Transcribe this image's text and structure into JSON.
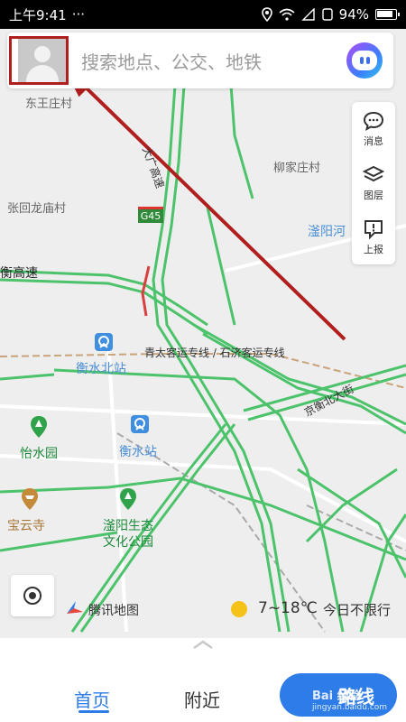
{
  "status_bar": {
    "time": "上午9:41",
    "dots": "···",
    "battery": "94%"
  },
  "search": {
    "placeholder": "搜索地点、公交、地铁"
  },
  "tools": [
    {
      "label": "消息",
      "icon": "message-icon"
    },
    {
      "label": "图层",
      "icon": "layers-icon"
    },
    {
      "label": "上报",
      "icon": "report-icon"
    }
  ],
  "map_labels": {
    "village_1": "东王庄村",
    "village_2": "柳家庄村",
    "village_3": "张回龙庙村",
    "river": "滏阳河",
    "highway_name": "大广高速",
    "highway_shield": "G45",
    "heng_highway": "衡高速",
    "rail_line": "青太客运专线 / 石济客运专线",
    "station_north": "衡水北站",
    "station": "衡水站",
    "park_1": "怡水园",
    "temple": "宝云寺",
    "park_2_line1": "滏阳生态",
    "park_2_line2": "文化公园",
    "street": "京衡北大街",
    "map_brand": "腾讯地图"
  },
  "weather": {
    "temperature": "7~18℃",
    "restriction": "今日不限行",
    "icon": "sun-icon"
  },
  "bottom_nav": {
    "home": "首页",
    "nearby": "附近",
    "route": "路线"
  },
  "watermark": {
    "text": "Bai 经验",
    "sub": "jingyan.baidu.com"
  },
  "colors": {
    "accent": "#2d7ce8",
    "road_green": "#4cc36b",
    "highlight_red": "#b01e1e",
    "rail": "#c9a47a"
  }
}
